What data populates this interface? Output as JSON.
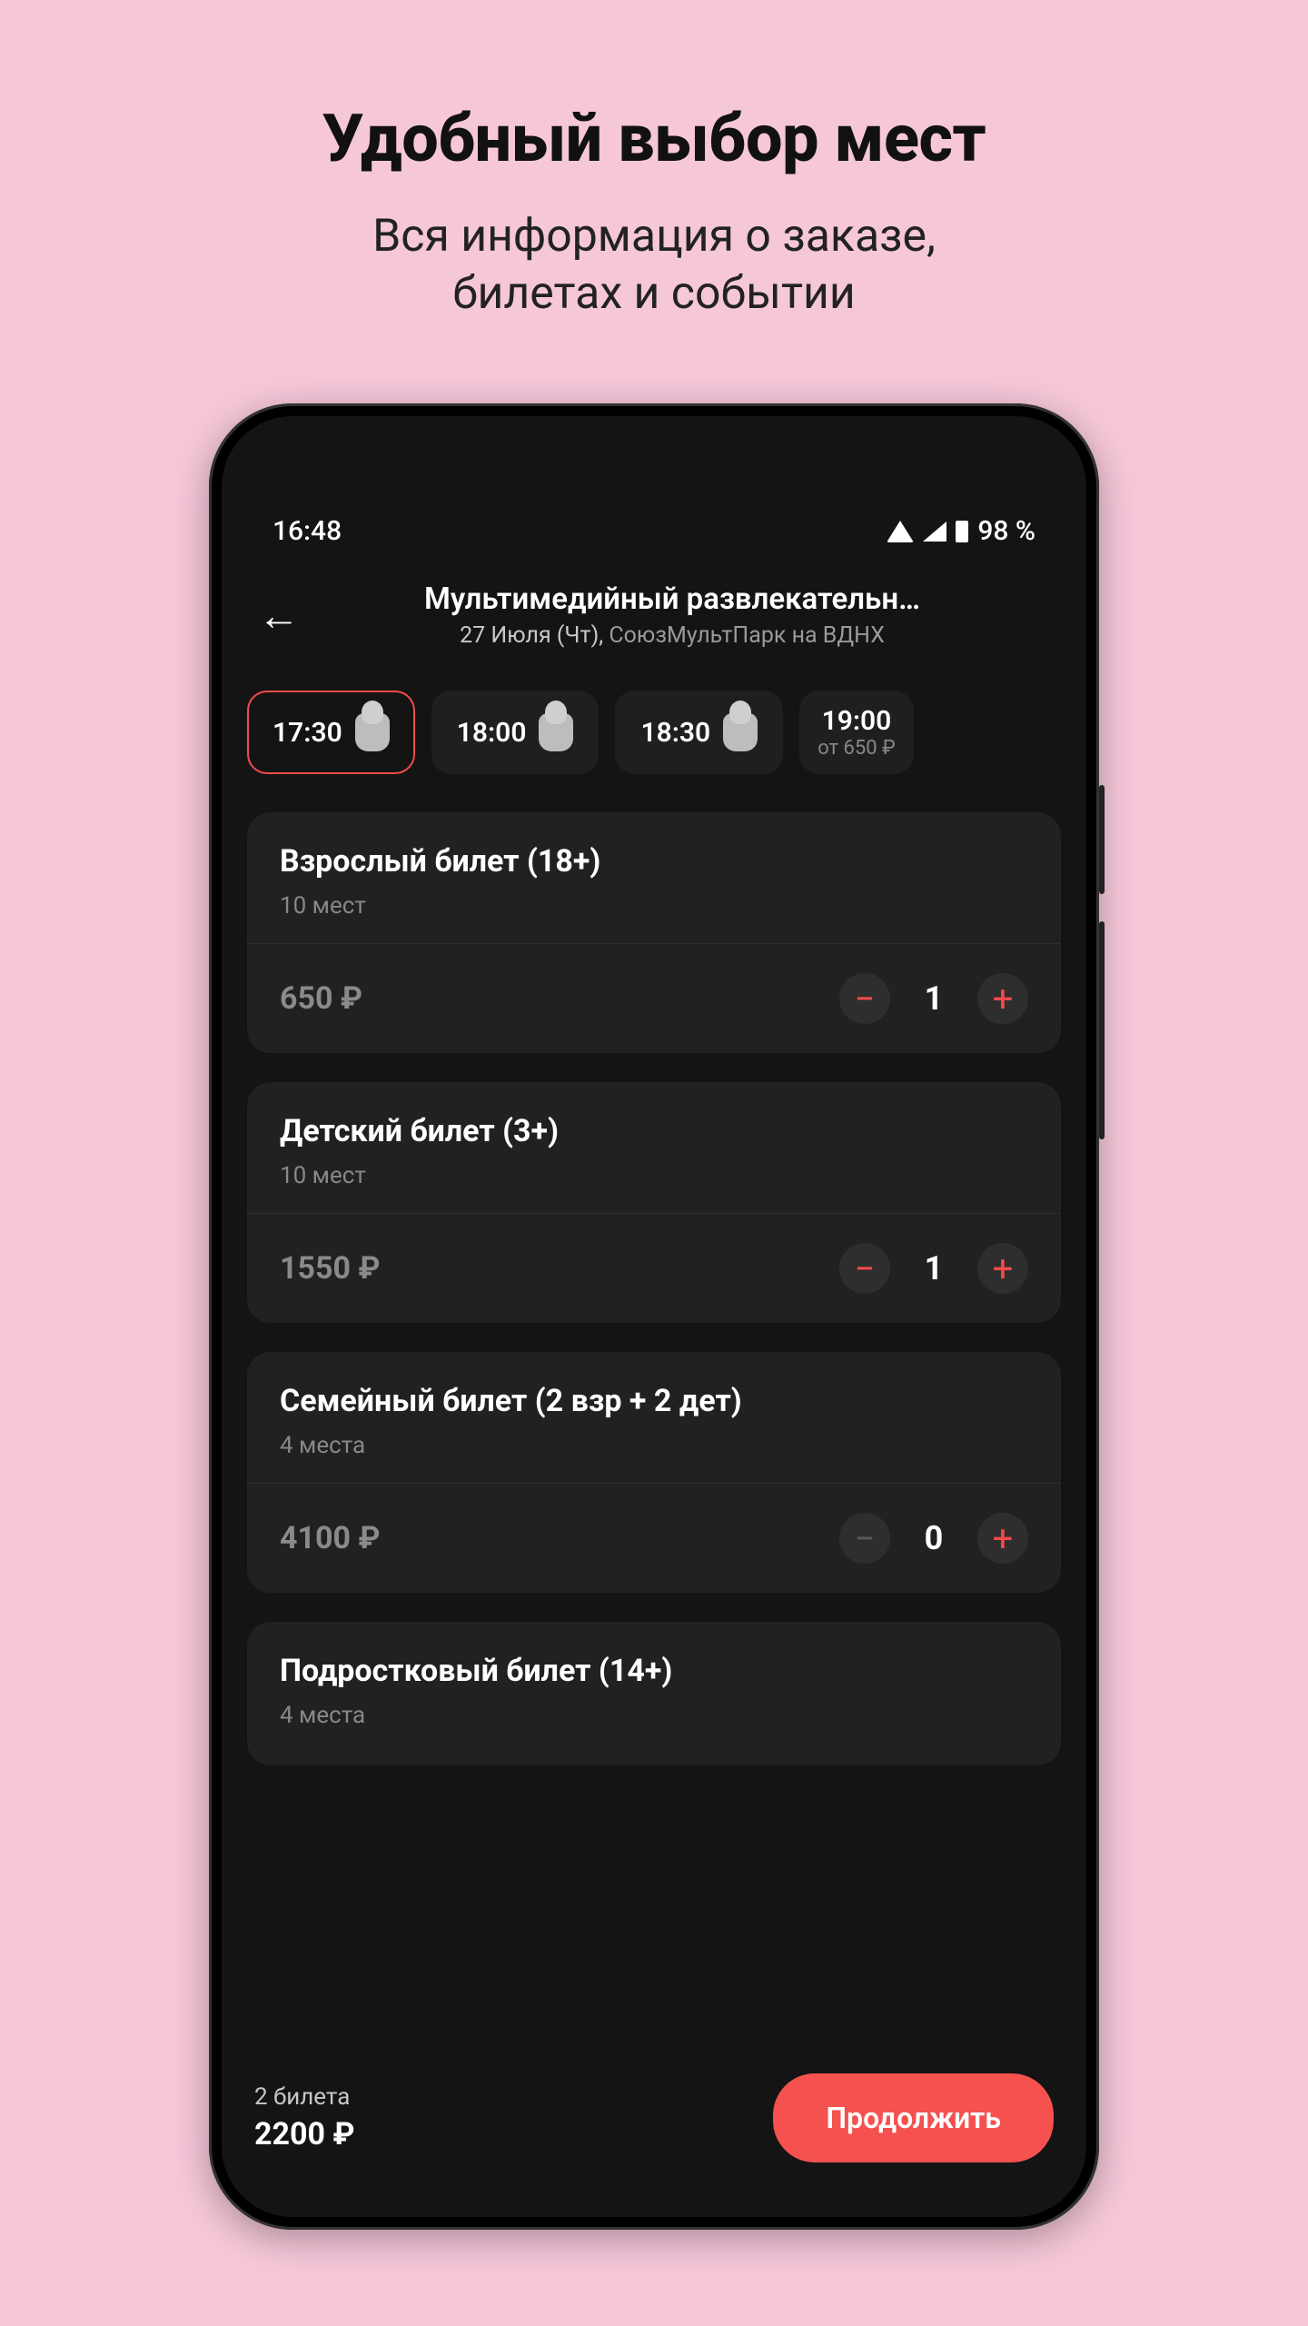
{
  "marketing": {
    "heading": "Удобный выбор мест",
    "sub_line1": "Вся информация о заказе,",
    "sub_line2": "билетах и событии"
  },
  "status": {
    "time": "16:48",
    "battery": "98 %"
  },
  "header": {
    "title": "Мультимедийный развлекательн…",
    "date": "27 Июля (Чт),",
    "venue": "СоюзМультПарк на ВДНХ"
  },
  "times": [
    {
      "label": "17:30",
      "selected": true
    },
    {
      "label": "18:00",
      "selected": false
    },
    {
      "label": "18:30",
      "selected": false
    },
    {
      "label": "19:00",
      "sub": "от 650 ₽",
      "selected": false
    }
  ],
  "tickets": [
    {
      "title": "Взрослый билет (18+)",
      "seats": "10 мест",
      "price": "650 ₽",
      "qty": "1",
      "minusDisabled": false
    },
    {
      "title": "Детский билет (3+)",
      "seats": "10 мест",
      "price": "1550 ₽",
      "qty": "1",
      "minusDisabled": false
    },
    {
      "title": "Семейный билет (2 взр + 2 дет)",
      "seats": "4 места",
      "price": "4100 ₽",
      "qty": "0",
      "minusDisabled": true
    },
    {
      "title": "Подростковый билет (14+)",
      "seats": "4 места"
    }
  ],
  "footer": {
    "count": "2 билета",
    "total": "2200 ₽",
    "cta": "Продолжить"
  }
}
